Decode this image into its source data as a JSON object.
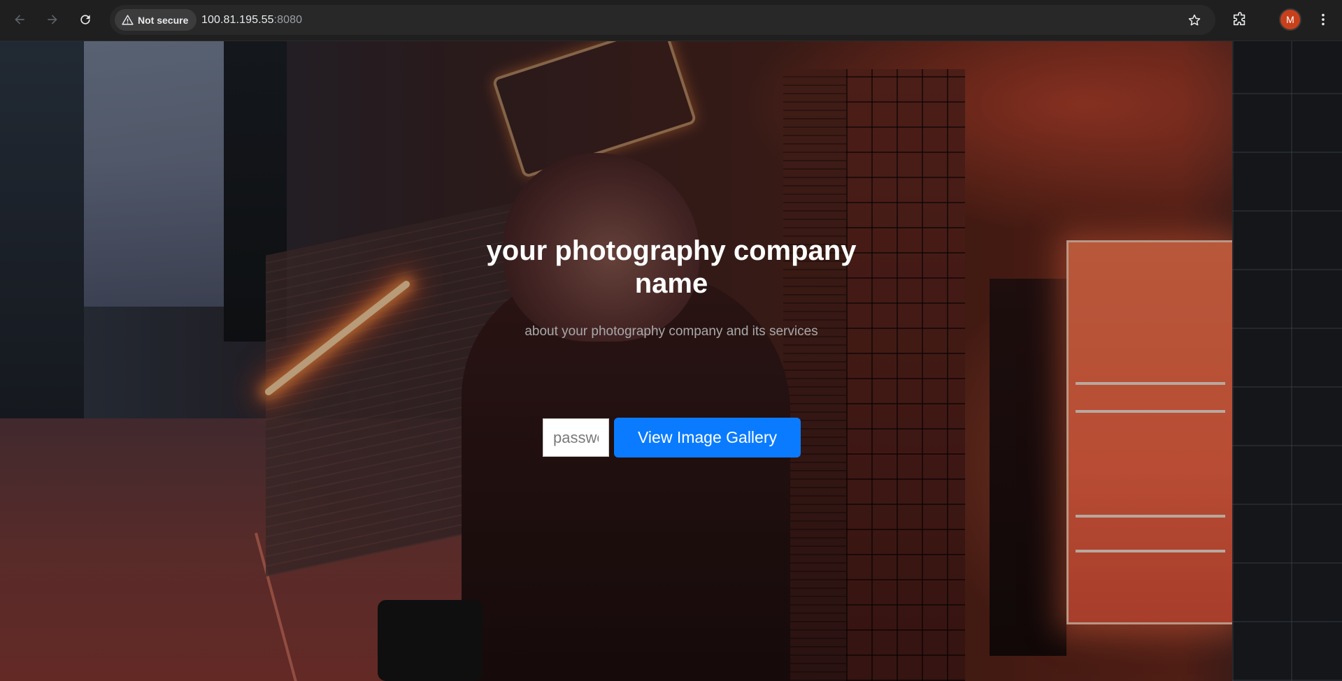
{
  "browser": {
    "security_label": "Not secure",
    "url_host": "100.81.195.55",
    "url_port": ":8080",
    "profile_initial": "M",
    "icons": [
      "back-arrow-icon",
      "forward-arrow-icon",
      "reload-icon",
      "warning-triangle-icon",
      "star-icon",
      "extensions-puzzle-icon",
      "kebab-menu-icon"
    ],
    "colors": {
      "chrome_bg": "#1f1f1f",
      "omnibox_bg": "#282828",
      "avatar_bg": "#c8401b"
    }
  },
  "hero": {
    "title": "your photography company name",
    "subtitle": "about your photography company and its services",
    "password_placeholder": "password",
    "gallery_button_label": "View Image Gallery",
    "colors": {
      "button_bg": "#0a7bff",
      "title": "#ffffff",
      "subtitle": "#a9a9a9"
    }
  }
}
